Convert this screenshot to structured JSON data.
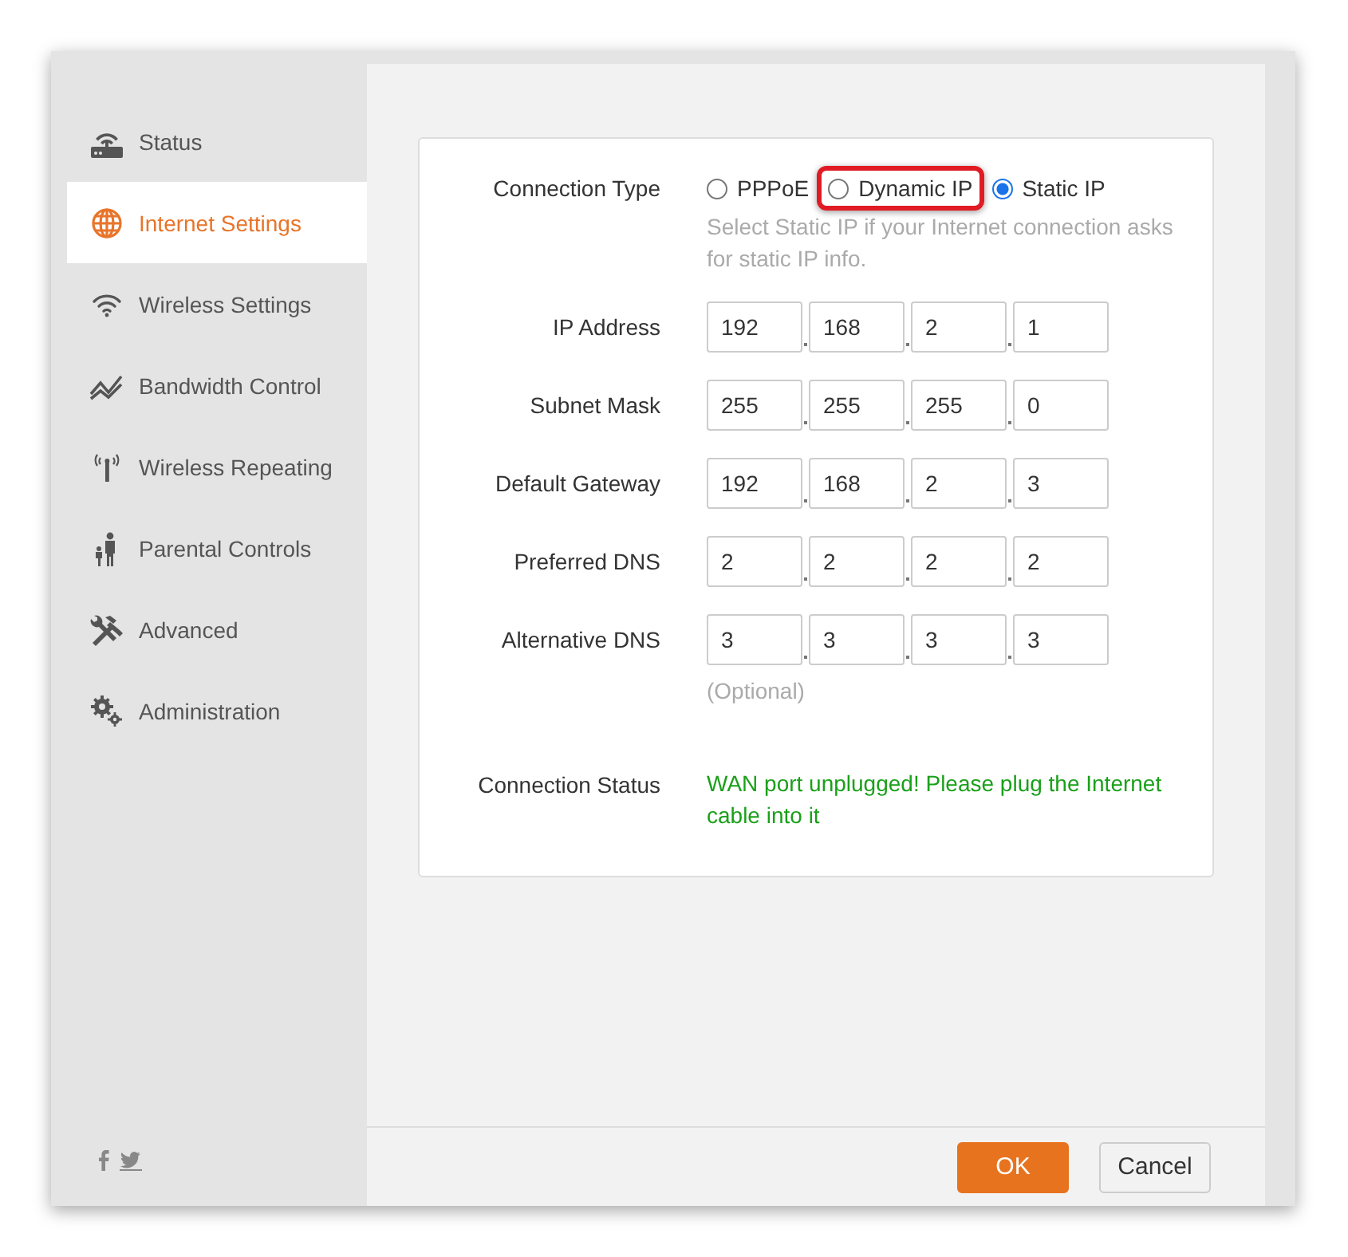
{
  "sidebar": {
    "items": [
      {
        "label": "Status",
        "selected": false
      },
      {
        "label": "Internet Settings",
        "selected": true
      },
      {
        "label": "Wireless Settings",
        "selected": false
      },
      {
        "label": "Bandwidth Control",
        "selected": false
      },
      {
        "label": "Wireless Repeating",
        "selected": false
      },
      {
        "label": "Parental Controls",
        "selected": false
      },
      {
        "label": "Advanced",
        "selected": false
      },
      {
        "label": "Administration",
        "selected": false
      }
    ]
  },
  "connection_type": {
    "label": "Connection Type",
    "options": [
      {
        "label": "PPPoE",
        "selected": false,
        "highlighted": false
      },
      {
        "label": "Dynamic IP",
        "selected": false,
        "highlighted": true
      },
      {
        "label": "Static IP",
        "selected": true,
        "highlighted": false
      }
    ],
    "hint": "Select Static IP if your Internet connection asks for static IP info."
  },
  "fields": [
    {
      "label": "IP Address",
      "octets": [
        "192",
        "168",
        "2",
        "1"
      ]
    },
    {
      "label": "Subnet Mask",
      "octets": [
        "255",
        "255",
        "255",
        "0"
      ]
    },
    {
      "label": "Default Gateway",
      "octets": [
        "192",
        "168",
        "2",
        "3"
      ]
    },
    {
      "label": "Preferred DNS",
      "octets": [
        "2",
        "2",
        "2",
        "2"
      ]
    },
    {
      "label": "Alternative DNS",
      "octets": [
        "3",
        "3",
        "3",
        "3"
      ],
      "note": "(Optional)"
    }
  ],
  "connection_status": {
    "label": "Connection Status",
    "message": "WAN port unplugged! Please plug the Internet cable into it"
  },
  "buttons": [
    {
      "label": "OK",
      "kind": "primary"
    },
    {
      "label": "Cancel",
      "kind": "secondary"
    }
  ]
}
